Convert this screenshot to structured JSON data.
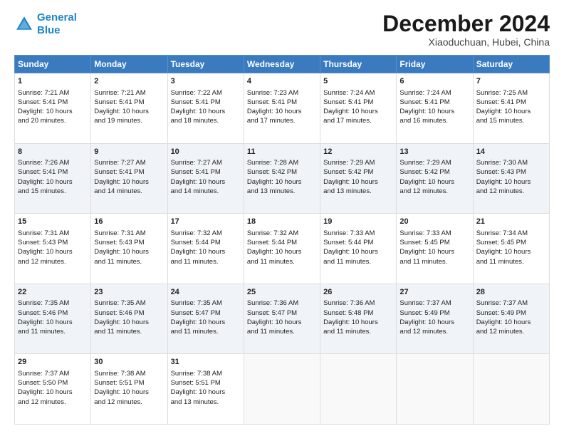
{
  "logo": {
    "line1": "General",
    "line2": "Blue"
  },
  "title": "December 2024",
  "subtitle": "Xiaoduchuan, Hubei, China",
  "weekdays": [
    "Sunday",
    "Monday",
    "Tuesday",
    "Wednesday",
    "Thursday",
    "Friday",
    "Saturday"
  ],
  "weeks": [
    [
      {
        "day": 1,
        "lines": [
          "Sunrise: 7:21 AM",
          "Sunset: 5:41 PM",
          "Daylight: 10 hours",
          "and 20 minutes."
        ]
      },
      {
        "day": 2,
        "lines": [
          "Sunrise: 7:21 AM",
          "Sunset: 5:41 PM",
          "Daylight: 10 hours",
          "and 19 minutes."
        ]
      },
      {
        "day": 3,
        "lines": [
          "Sunrise: 7:22 AM",
          "Sunset: 5:41 PM",
          "Daylight: 10 hours",
          "and 18 minutes."
        ]
      },
      {
        "day": 4,
        "lines": [
          "Sunrise: 7:23 AM",
          "Sunset: 5:41 PM",
          "Daylight: 10 hours",
          "and 17 minutes."
        ]
      },
      {
        "day": 5,
        "lines": [
          "Sunrise: 7:24 AM",
          "Sunset: 5:41 PM",
          "Daylight: 10 hours",
          "and 17 minutes."
        ]
      },
      {
        "day": 6,
        "lines": [
          "Sunrise: 7:24 AM",
          "Sunset: 5:41 PM",
          "Daylight: 10 hours",
          "and 16 minutes."
        ]
      },
      {
        "day": 7,
        "lines": [
          "Sunrise: 7:25 AM",
          "Sunset: 5:41 PM",
          "Daylight: 10 hours",
          "and 15 minutes."
        ]
      }
    ],
    [
      {
        "day": 8,
        "lines": [
          "Sunrise: 7:26 AM",
          "Sunset: 5:41 PM",
          "Daylight: 10 hours",
          "and 15 minutes."
        ]
      },
      {
        "day": 9,
        "lines": [
          "Sunrise: 7:27 AM",
          "Sunset: 5:41 PM",
          "Daylight: 10 hours",
          "and 14 minutes."
        ]
      },
      {
        "day": 10,
        "lines": [
          "Sunrise: 7:27 AM",
          "Sunset: 5:41 PM",
          "Daylight: 10 hours",
          "and 14 minutes."
        ]
      },
      {
        "day": 11,
        "lines": [
          "Sunrise: 7:28 AM",
          "Sunset: 5:42 PM",
          "Daylight: 10 hours",
          "and 13 minutes."
        ]
      },
      {
        "day": 12,
        "lines": [
          "Sunrise: 7:29 AM",
          "Sunset: 5:42 PM",
          "Daylight: 10 hours",
          "and 13 minutes."
        ]
      },
      {
        "day": 13,
        "lines": [
          "Sunrise: 7:29 AM",
          "Sunset: 5:42 PM",
          "Daylight: 10 hours",
          "and 12 minutes."
        ]
      },
      {
        "day": 14,
        "lines": [
          "Sunrise: 7:30 AM",
          "Sunset: 5:43 PM",
          "Daylight: 10 hours",
          "and 12 minutes."
        ]
      }
    ],
    [
      {
        "day": 15,
        "lines": [
          "Sunrise: 7:31 AM",
          "Sunset: 5:43 PM",
          "Daylight: 10 hours",
          "and 12 minutes."
        ]
      },
      {
        "day": 16,
        "lines": [
          "Sunrise: 7:31 AM",
          "Sunset: 5:43 PM",
          "Daylight: 10 hours",
          "and 11 minutes."
        ]
      },
      {
        "day": 17,
        "lines": [
          "Sunrise: 7:32 AM",
          "Sunset: 5:44 PM",
          "Daylight: 10 hours",
          "and 11 minutes."
        ]
      },
      {
        "day": 18,
        "lines": [
          "Sunrise: 7:32 AM",
          "Sunset: 5:44 PM",
          "Daylight: 10 hours",
          "and 11 minutes."
        ]
      },
      {
        "day": 19,
        "lines": [
          "Sunrise: 7:33 AM",
          "Sunset: 5:44 PM",
          "Daylight: 10 hours",
          "and 11 minutes."
        ]
      },
      {
        "day": 20,
        "lines": [
          "Sunrise: 7:33 AM",
          "Sunset: 5:45 PM",
          "Daylight: 10 hours",
          "and 11 minutes."
        ]
      },
      {
        "day": 21,
        "lines": [
          "Sunrise: 7:34 AM",
          "Sunset: 5:45 PM",
          "Daylight: 10 hours",
          "and 11 minutes."
        ]
      }
    ],
    [
      {
        "day": 22,
        "lines": [
          "Sunrise: 7:35 AM",
          "Sunset: 5:46 PM",
          "Daylight: 10 hours",
          "and 11 minutes."
        ]
      },
      {
        "day": 23,
        "lines": [
          "Sunrise: 7:35 AM",
          "Sunset: 5:46 PM",
          "Daylight: 10 hours",
          "and 11 minutes."
        ]
      },
      {
        "day": 24,
        "lines": [
          "Sunrise: 7:35 AM",
          "Sunset: 5:47 PM",
          "Daylight: 10 hours",
          "and 11 minutes."
        ]
      },
      {
        "day": 25,
        "lines": [
          "Sunrise: 7:36 AM",
          "Sunset: 5:47 PM",
          "Daylight: 10 hours",
          "and 11 minutes."
        ]
      },
      {
        "day": 26,
        "lines": [
          "Sunrise: 7:36 AM",
          "Sunset: 5:48 PM",
          "Daylight: 10 hours",
          "and 11 minutes."
        ]
      },
      {
        "day": 27,
        "lines": [
          "Sunrise: 7:37 AM",
          "Sunset: 5:49 PM",
          "Daylight: 10 hours",
          "and 12 minutes."
        ]
      },
      {
        "day": 28,
        "lines": [
          "Sunrise: 7:37 AM",
          "Sunset: 5:49 PM",
          "Daylight: 10 hours",
          "and 12 minutes."
        ]
      }
    ],
    [
      {
        "day": 29,
        "lines": [
          "Sunrise: 7:37 AM",
          "Sunset: 5:50 PM",
          "Daylight: 10 hours",
          "and 12 minutes."
        ]
      },
      {
        "day": 30,
        "lines": [
          "Sunrise: 7:38 AM",
          "Sunset: 5:51 PM",
          "Daylight: 10 hours",
          "and 12 minutes."
        ]
      },
      {
        "day": 31,
        "lines": [
          "Sunrise: 7:38 AM",
          "Sunset: 5:51 PM",
          "Daylight: 10 hours",
          "and 13 minutes."
        ]
      },
      null,
      null,
      null,
      null
    ]
  ]
}
